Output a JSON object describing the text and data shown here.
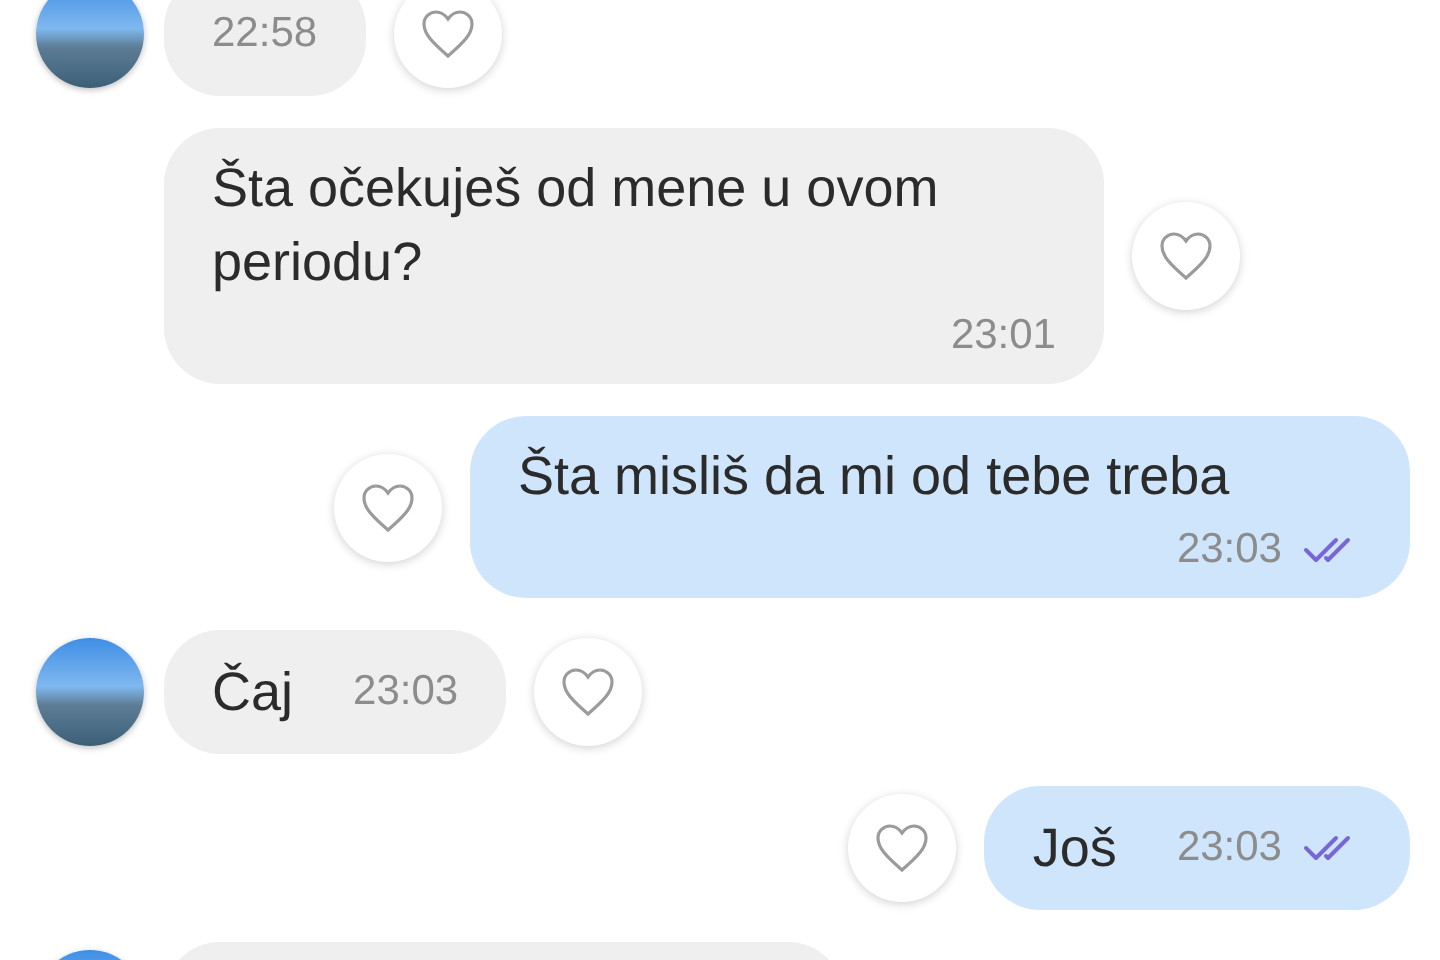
{
  "messages": [
    {
      "kind": "incoming",
      "avatar": true,
      "time": "22:58",
      "liked": false
    },
    {
      "kind": "incoming",
      "avatar": false,
      "text": "Šta očekuješ od mene u ovom periodu?",
      "time": "23:01",
      "liked": false
    },
    {
      "kind": "outgoing",
      "text": "Šta misliš da mi od tebe treba",
      "time": "23:03",
      "read": true,
      "liked": false
    },
    {
      "kind": "incoming",
      "avatar": true,
      "text": "Čaj",
      "time": "23:03",
      "liked": false
    },
    {
      "kind": "outgoing",
      "text": "Još",
      "time": "23:03",
      "read": true,
      "liked": false
    },
    {
      "kind": "incoming",
      "avatar": true
    }
  ]
}
